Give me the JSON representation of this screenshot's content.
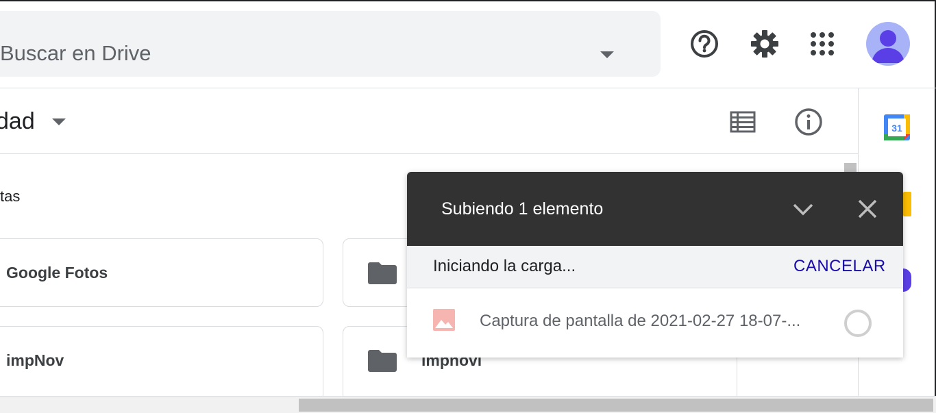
{
  "search": {
    "placeholder": "Buscar en Drive"
  },
  "header": {
    "help_icon": "help-circle-icon",
    "settings_icon": "gear-icon",
    "apps_icon": "apps-grid-icon",
    "avatar_icon": "account-avatar-icon"
  },
  "subheader": {
    "title": "dad"
  },
  "section": {
    "label": "tas"
  },
  "cards": [
    {
      "label": "Google Fotos"
    },
    {
      "label": "impNov"
    },
    {
      "label": "impnovi"
    }
  ],
  "upload": {
    "title": "Subiendo 1 elemento",
    "status": "Iniciando la carga...",
    "cancel_label": "CANCELAR",
    "file_name": "Captura de pantalla de 2021-02-27 18-07-..."
  },
  "side_rail": {
    "calendar_day": "31"
  },
  "colors": {
    "panel_header": "#323232",
    "cancel_link": "#1a0dab",
    "avatar_bg": "#a8b2f7",
    "avatar_fg": "#5b3fe6"
  }
}
